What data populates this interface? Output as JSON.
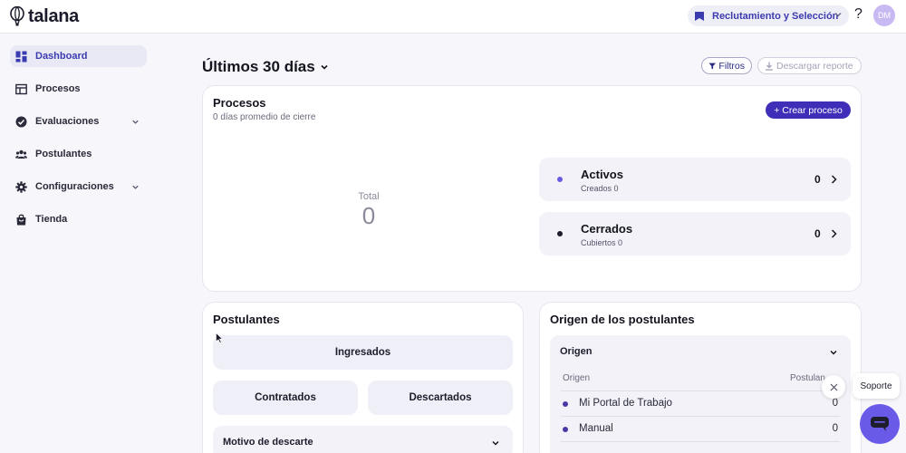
{
  "header": {
    "logo_text": "talana",
    "module_label": "Reclutamiento y Selección",
    "help_label": "?",
    "avatar_initials": "DM"
  },
  "sidebar": {
    "items": [
      {
        "label": "Dashboard",
        "icon": "dashboard-icon",
        "active": true
      },
      {
        "label": "Procesos",
        "icon": "table-icon"
      },
      {
        "label": "Evaluaciones",
        "icon": "check-circle-icon",
        "expandable": true
      },
      {
        "label": "Postulantes",
        "icon": "users-icon"
      },
      {
        "label": "Configuraciones",
        "icon": "gear-icon",
        "expandable": true
      },
      {
        "label": "Tienda",
        "icon": "shopping-bag-icon"
      }
    ]
  },
  "main": {
    "period_title": "Últimos 30 días",
    "filter_label": "Filtros",
    "download_label": "Descargar reporte"
  },
  "procesos": {
    "title": "Procesos",
    "subtitle": "0 días promedio de cierre",
    "create_label": "+ Crear proceso",
    "total_label": "Total",
    "total_value": "0",
    "stats": [
      {
        "name": "Activos",
        "sub": "Creados 0",
        "count": "0",
        "dot_color": "#6a5ae8"
      },
      {
        "name": "Cerrados",
        "sub": "Cubiertos 0",
        "count": "0",
        "dot_color": "#1d1d2c"
      }
    ]
  },
  "postulantes": {
    "title": "Postulantes",
    "ingresados_label": "Ingresados",
    "contratados_label": "Contratados",
    "descartados_label": "Descartados",
    "motivo_label": "Motivo de descarte"
  },
  "origen": {
    "title": "Origen de los postulantes",
    "accordion_label": "Origen",
    "col_origin": "Origen",
    "col_count": "Postulan",
    "rows": [
      {
        "label": "Mi Portal de Trabajo",
        "value": "0"
      },
      {
        "label": "Manual",
        "value": "0"
      }
    ]
  },
  "support": {
    "label": "Soporte"
  },
  "colors": {
    "accent": "#3f2fb8",
    "support": "#6a5ae8"
  }
}
